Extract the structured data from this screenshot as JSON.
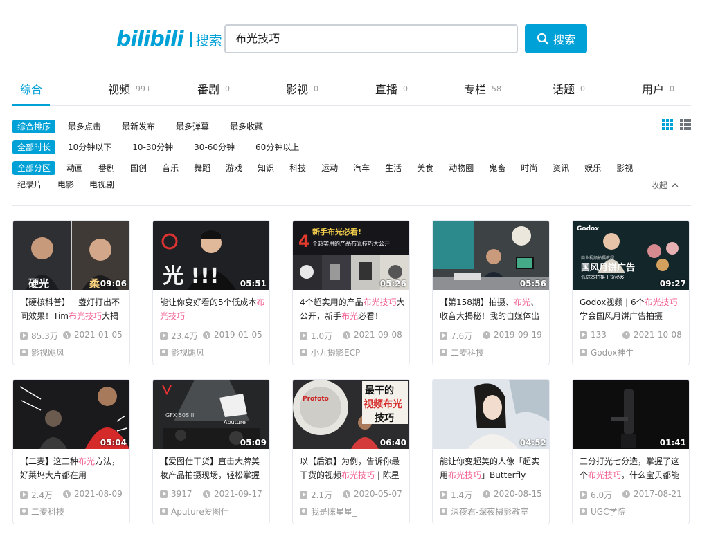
{
  "header": {
    "logo": "bilibili",
    "logo_sub": "搜索",
    "search_value": "布光技巧",
    "search_button": "搜索"
  },
  "tabs": [
    {
      "label": "综合",
      "count": ""
    },
    {
      "label": "视频",
      "count": "99+"
    },
    {
      "label": "番剧",
      "count": "0"
    },
    {
      "label": "影视",
      "count": "0"
    },
    {
      "label": "直播",
      "count": "0"
    },
    {
      "label": "专栏",
      "count": "58"
    },
    {
      "label": "话题",
      "count": "0"
    },
    {
      "label": "用户",
      "count": "0"
    }
  ],
  "filters": {
    "sort": [
      "综合排序",
      "最多点击",
      "最新发布",
      "最多弹幕",
      "最多收藏"
    ],
    "duration": [
      "全部时长",
      "10分钟以下",
      "10-30分钟",
      "30-60分钟",
      "60分钟以上"
    ],
    "zone_row1": [
      "全部分区",
      "动画",
      "番剧",
      "国创",
      "音乐",
      "舞蹈",
      "游戏",
      "知识",
      "科技",
      "运动",
      "汽车",
      "生活",
      "美食",
      "动物圈",
      "鬼畜",
      "时尚",
      "资讯",
      "娱乐",
      "影视"
    ],
    "zone_row2": [
      "纪录片",
      "电影",
      "电视剧"
    ],
    "collapse_label": "收起"
  },
  "videos": [
    {
      "duration": "09:06",
      "title_parts": [
        "【硬核科普】一盏灯打出不同效果！Tim",
        "布光技巧",
        "大揭"
      ],
      "views": "85.3万",
      "date": "2021-01-05",
      "uploader": "影视飓风"
    },
    {
      "duration": "05:51",
      "title_parts": [
        "能让你变好看的5个低成本",
        "布光技巧",
        ""
      ],
      "views": "23.4万",
      "date": "2019-01-05",
      "uploader": "影视飓风"
    },
    {
      "duration": "05:26",
      "title_parts": [
        "4个超实用的产品",
        "布光技巧",
        "大公开，新手",
        "布光",
        "必看！"
      ],
      "views": "1.0万",
      "date": "2021-09-08",
      "uploader": "小九摄影ECP"
    },
    {
      "duration": "05:56",
      "title_parts": [
        "【第158期】拍摄、",
        "布光",
        "、收音大揭秘！我的自媒体出"
      ],
      "views": "7.6万",
      "date": "2019-09-19",
      "uploader": "二麦科技"
    },
    {
      "duration": "09:27",
      "title_parts": [
        "Godox视频 | 6个",
        "布光技巧",
        "学会国风月饼广告拍摄"
      ],
      "views": "133",
      "date": "2021-10-08",
      "uploader": "Godox神牛"
    },
    {
      "duration": "05:04",
      "title_parts": [
        "【二麦】这三种",
        "布光",
        "方法，好莱坞大片都在用"
      ],
      "views": "2.4万",
      "date": "2021-08-09",
      "uploader": "二麦科技"
    },
    {
      "duration": "05:09",
      "title_parts": [
        "【爱图仕干货】直击大牌美妆产品拍摄现场，轻松掌握",
        "",
        ""
      ],
      "views": "3917",
      "date": "2021-09-17",
      "uploader": "Aputure爱图仕"
    },
    {
      "duration": "06:40",
      "title_parts": [
        "以【后浪】为例，告诉你最干货的视频",
        "布光技巧",
        " | 陈星"
      ],
      "views": "2.1万",
      "date": "2020-05-07",
      "uploader": "我是陈星星_"
    },
    {
      "duration": "04:52",
      "title_parts": [
        "能让你变超美的人像「超实用",
        "布光技巧",
        "」Butterfly"
      ],
      "views": "1.4万",
      "date": "2020-08-15",
      "uploader": "深夜君-深夜摄影教室"
    },
    {
      "duration": "01:41",
      "title_parts": [
        "三分打光七分造，掌握了这个",
        "布光技巧",
        "，什么宝贝都能"
      ],
      "views": "6.0万",
      "date": "2017-08-21",
      "uploader": "UGC学院"
    }
  ],
  "thumb_text": {
    "v0_a": "硬光",
    "v0_b": "柔",
    "v1": "光 !!!",
    "v2_a": "4",
    "v2_b": "新手布光必看!",
    "v2_c": "个超实用的产品布光技巧大公开!",
    "v4_brand": "Godox",
    "v4_top": "商业视频拍摄教程",
    "v4_a": "国风月饼广告",
    "v4_b": "低成本拍摄干货秘笈",
    "v6_a": "GFX 50S II",
    "v6_b": "Aputure",
    "v7_a": "最干的",
    "v7_b": "视频布光",
    "v7_c": "技巧",
    "v7_brand": "Profoto"
  },
  "colors": {
    "accent": "#00a1d6",
    "highlight": "#f25d8e"
  }
}
